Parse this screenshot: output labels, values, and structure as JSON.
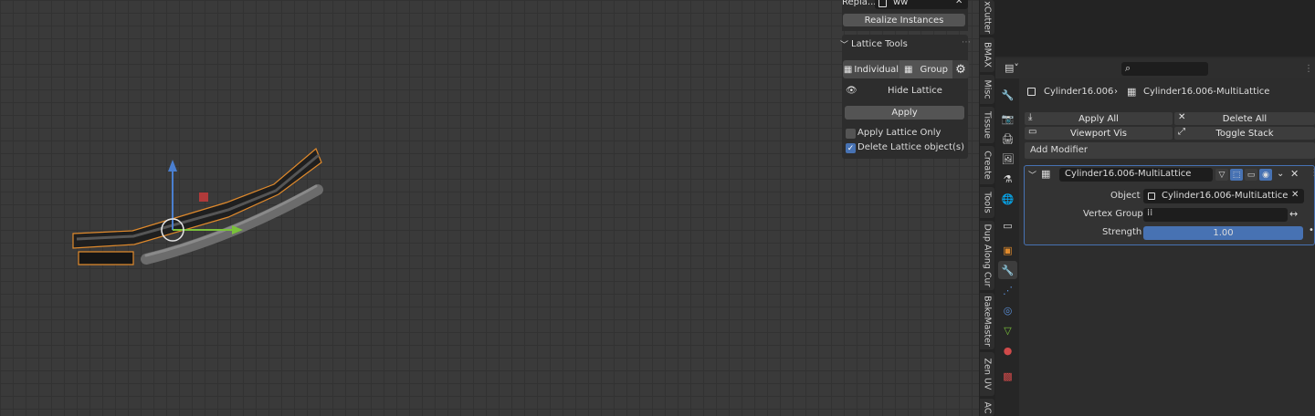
{
  "npanel": {
    "replace_label": "Repla...",
    "replace_value": "ww",
    "realize_button": "Realize Instances",
    "section_title": "Lattice Tools",
    "individual_label": "Individual",
    "group_label": "Group",
    "hide_lattice_label": "Hide Lattice",
    "apply_button": "Apply",
    "apply_lattice_only_label": "Apply Lattice Only",
    "apply_lattice_only_checked": false,
    "delete_lattice_label": "Delete Lattice object(s)",
    "delete_lattice_checked": true
  },
  "tabs": [
    "xCutter",
    "BMAX",
    "Misc",
    "Tissue",
    "Create",
    "Tools",
    "Dup Along Cur",
    "BakeMaster",
    "Zen UV",
    "AC"
  ],
  "properties": {
    "breadcrumb_object": "Cylinder16.006",
    "breadcrumb_modifier": "Cylinder16.006-MultiLattice",
    "apply_all": "Apply All",
    "delete_all": "Delete All",
    "viewport_vis": "Viewport Vis",
    "toggle_stack": "Toggle Stack",
    "add_modifier": "Add Modifier",
    "modifier": {
      "name": "Cylinder16.006-MultiLattice",
      "object_label": "Object",
      "object_value": "Cylinder16.006-MultiLattice",
      "vertex_group_label": "Vertex Group",
      "vertex_group_value": "",
      "strength_label": "Strength",
      "strength_value": "1.00"
    }
  },
  "colors": {
    "accent_blue": "#4772b3",
    "selection_orange": "#e08a2c",
    "axis_z": "#4a7fd0",
    "axis_y": "#7ac23a",
    "axis_x_handle": "#b03a3a"
  }
}
